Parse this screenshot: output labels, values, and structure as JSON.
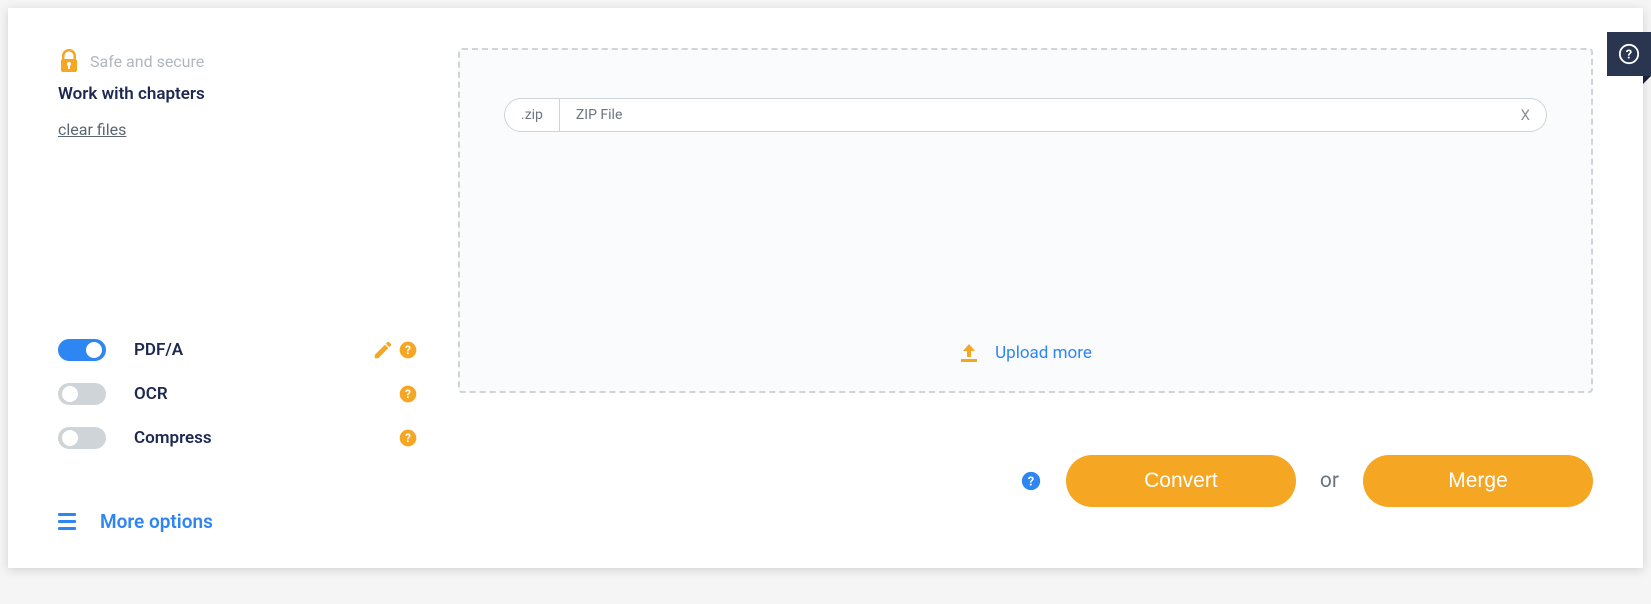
{
  "secure_text": "Safe and secure",
  "chapters_text": "Work with chapters",
  "clear_files": "clear files",
  "toggles": {
    "pdfa": {
      "label": "PDF/A",
      "on": true,
      "editable": true
    },
    "ocr": {
      "label": "OCR",
      "on": false,
      "editable": false
    },
    "compress": {
      "label": "Compress",
      "on": false,
      "editable": false
    }
  },
  "more_options": "More options",
  "file": {
    "ext": ".zip",
    "name": "ZIP File",
    "remove": "X"
  },
  "upload_more": "Upload more",
  "convert_label": "Convert",
  "or_label": "or",
  "merge_label": "Merge"
}
